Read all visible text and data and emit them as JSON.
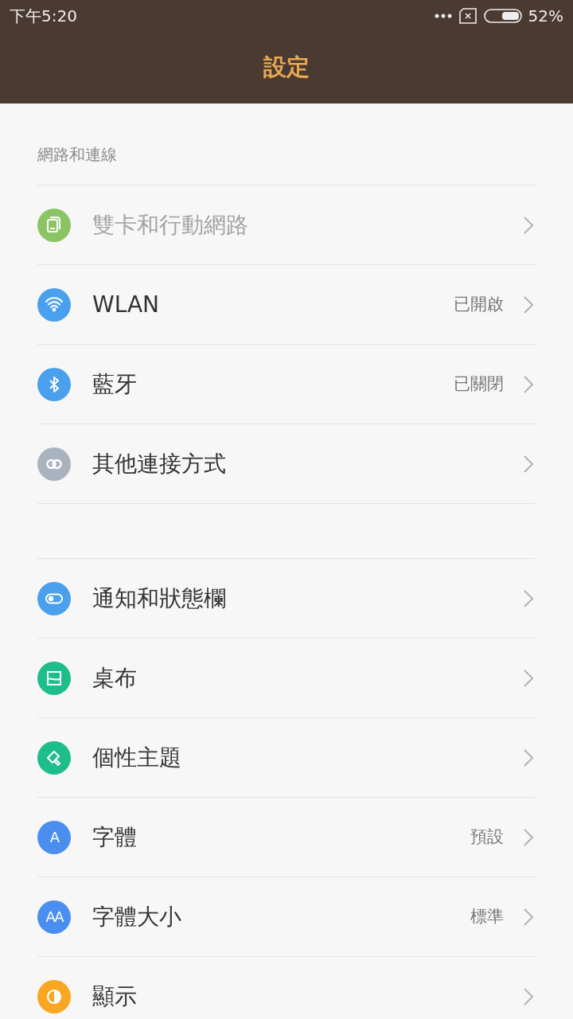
{
  "status_bar": {
    "time": "下午5:20",
    "battery": "52%"
  },
  "header": {
    "title": "設定"
  },
  "sections": [
    {
      "title": "網路和連線",
      "items": [
        {
          "label": "雙卡和行動網路",
          "disabled": true,
          "color": "#8bc563"
        },
        {
          "label": "WLAN",
          "value": "已開啟",
          "disabled": false,
          "color": "#4ba0ee"
        },
        {
          "label": "藍牙",
          "value": "已關閉",
          "disabled": false,
          "color": "#4ba0ee"
        },
        {
          "label": "其他連接方式",
          "disabled": false,
          "color": "#a9b3bd"
        }
      ]
    },
    {
      "items": [
        {
          "label": "通知和狀態欄",
          "disabled": false,
          "color": "#4ba0ee"
        },
        {
          "label": "桌布",
          "disabled": false,
          "color": "#1ebd8c"
        },
        {
          "label": "個性主題",
          "disabled": false,
          "color": "#1ebd8c"
        },
        {
          "label": "字體",
          "value": "預設",
          "disabled": false,
          "color": "#4a8ff0",
          "glyph": "A"
        },
        {
          "label": "字體大小",
          "value": "標準",
          "disabled": false,
          "color": "#4a8ff0",
          "glyph": "AA"
        },
        {
          "label": "顯示",
          "disabled": false,
          "color": "#f9a623"
        }
      ]
    }
  ]
}
